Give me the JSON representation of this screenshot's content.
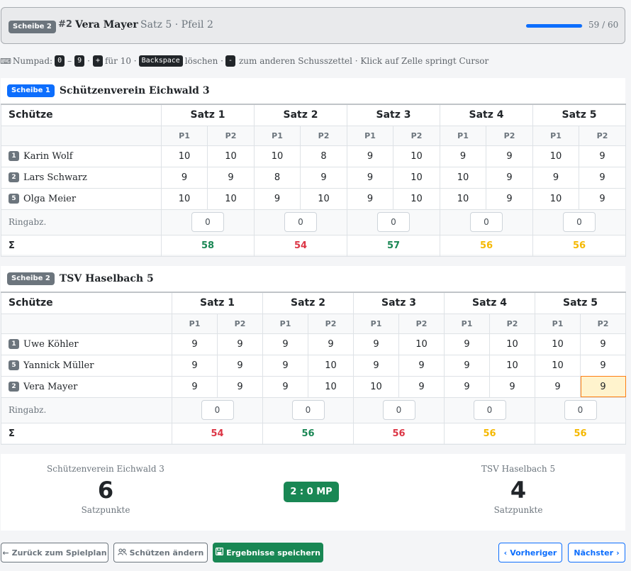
{
  "header": {
    "badge": "Scheibe 2",
    "shooter_num": "#2",
    "shooter_name": "Vera Mayer",
    "info": "Satz 5 · Pfeil 2",
    "progress_text": "59 / 60",
    "progress_fraction": 0.983
  },
  "hint": {
    "icon": "keyboard-icon",
    "numpad": "Numpad:",
    "k0": "0",
    "dash": "–",
    "k9": "9",
    "dot": "·",
    "kplus": "+",
    "fuer10": "für 10 ·",
    "kback": "Backspace",
    "loeschen": "löschen ·",
    "kminus": "-",
    "rest": "zum anderen Schusszettel · Klick auf Zelle springt Cursor"
  },
  "labels": {
    "schuetze": "Schütze",
    "ringabz": "Ringabz.",
    "sigma": "Σ",
    "sets": [
      "Satz 1",
      "Satz 2",
      "Satz 3",
      "Satz 4",
      "Satz 5"
    ],
    "p1": "P1",
    "p2": "P2"
  },
  "team1": {
    "badge": "Scheibe 1",
    "name": "Schützenverein Eichwald 3",
    "shooters": [
      {
        "pos": "1",
        "name": "Karin Wolf",
        "scores": [
          "10",
          "10",
          "10",
          "8",
          "9",
          "10",
          "9",
          "9",
          "10",
          "9"
        ]
      },
      {
        "pos": "2",
        "name": "Lars Schwarz",
        "scores": [
          "9",
          "9",
          "8",
          "9",
          "9",
          "10",
          "10",
          "9",
          "9",
          "9"
        ]
      },
      {
        "pos": "5",
        "name": "Olga Meier",
        "scores": [
          "10",
          "10",
          "9",
          "10",
          "9",
          "10",
          "10",
          "9",
          "10",
          "9"
        ]
      }
    ],
    "ringabz": [
      "0",
      "0",
      "0",
      "0",
      "0"
    ],
    "sums": [
      "58",
      "54",
      "57",
      "56",
      "56"
    ],
    "sum_colors": [
      "green",
      "red",
      "green",
      "yellow",
      "yellow"
    ]
  },
  "team2": {
    "badge": "Scheibe 2",
    "name": "TSV Haselbach 5",
    "shooters": [
      {
        "pos": "1",
        "name": "Uwe Köhler",
        "scores": [
          "9",
          "9",
          "9",
          "9",
          "9",
          "10",
          "9",
          "10",
          "10",
          "9"
        ]
      },
      {
        "pos": "5",
        "name": "Yannick Müller",
        "scores": [
          "9",
          "9",
          "9",
          "10",
          "9",
          "9",
          "9",
          "10",
          "10",
          "9"
        ]
      },
      {
        "pos": "2",
        "name": "Vera Mayer",
        "scores": [
          "9",
          "9",
          "9",
          "10",
          "10",
          "9",
          "9",
          "9",
          "9",
          "9"
        ]
      }
    ],
    "ringabz": [
      "0",
      "0",
      "0",
      "0",
      "0"
    ],
    "sums": [
      "54",
      "56",
      "56",
      "56",
      "56"
    ],
    "sum_colors": [
      "red",
      "green",
      "red",
      "yellow",
      "yellow"
    ]
  },
  "result": {
    "team1_name": "Schützenverein Eichwald 3",
    "team1_points": "6",
    "team1_label": "Satzpunkte",
    "mp": "2 : 0 MP",
    "team2_name": "TSV Haselbach 5",
    "team2_points": "4",
    "team2_label": "Satzpunkte"
  },
  "buttons": {
    "back": "Zurück zum Spielplan",
    "back_icon": "arrow-left-icon",
    "change": "Schützen ändern",
    "change_icon": "users-icon",
    "save": "Ergebnisse speichern",
    "save_icon": "floppy-disk-icon",
    "prev": "Vorheriger",
    "prev_icon": "chevron-left-icon",
    "next": "Nächster",
    "next_icon": "chevron-right-icon"
  }
}
